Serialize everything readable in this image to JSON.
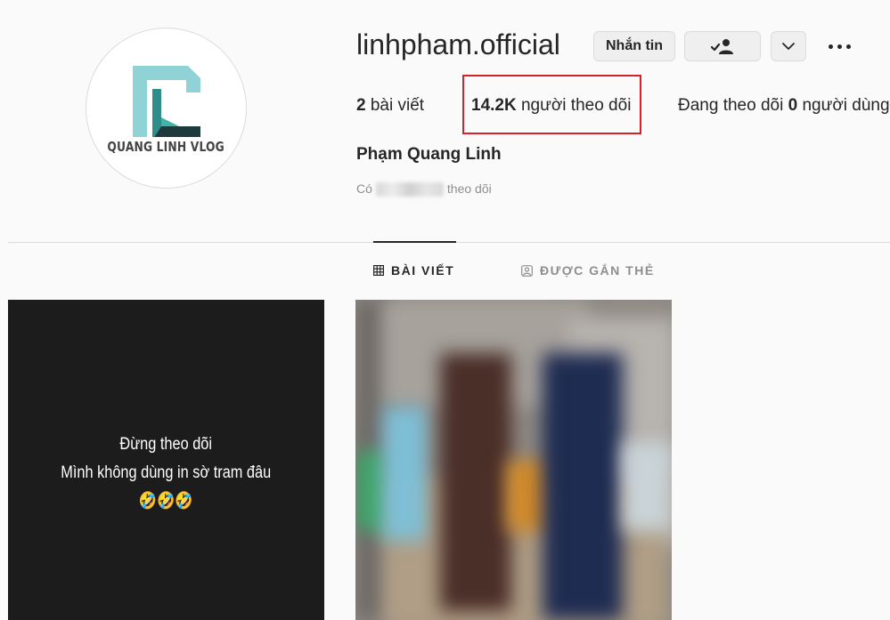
{
  "profile": {
    "avatar_text": "QUANG LINH VLOG",
    "username": "linhpham.official",
    "full_name": "Phạm Quang Linh",
    "mutual_prefix": "Có",
    "mutual_suffix": "theo dõi"
  },
  "actions": {
    "message_label": "Nhắn tin",
    "following_icon": "person-check-icon",
    "suggest_icon": "chevron-down-icon",
    "more_icon": "more-horizontal-icon"
  },
  "stats": {
    "posts_count": "2",
    "posts_label": "bài viết",
    "followers_count": "14.2K",
    "followers_label": "người theo dõi",
    "following_prefix": "Đang theo dõi",
    "following_count": "0",
    "following_label": "người dùng"
  },
  "tabs": [
    {
      "label": "BÀI VIẾT",
      "icon": "grid-icon",
      "active": true
    },
    {
      "label": "ĐƯỢC GẮN THẺ",
      "icon": "tag-icon",
      "active": false
    }
  ],
  "posts": [
    {
      "line1": "Đừng theo dõi",
      "line2": "Mình không dùng in sờ tram đâu",
      "line3": "🤣🤣🤣"
    }
  ],
  "colors": {
    "highlight": "#d4222a",
    "logo_teal": "#8fd3d6",
    "logo_dark": "#1f3a3d"
  }
}
